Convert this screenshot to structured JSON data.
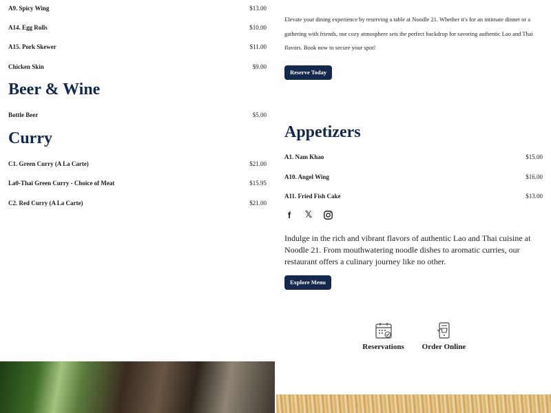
{
  "left_menu": {
    "top_items": [
      {
        "name": "A9. Spicy Wing",
        "price": "$13.00"
      },
      {
        "name": "A14. Egg Rolls",
        "price": "$10.00"
      },
      {
        "name": "A15. Pork Skewer",
        "price": "$11.00"
      },
      {
        "name": "Chicken Skin",
        "price": "$9.00"
      }
    ],
    "beer_heading": "Beer & Wine",
    "beer_items": [
      {
        "name": "Bottle Beer",
        "price": "$5.00"
      }
    ],
    "curry_heading": "Curry",
    "curry_items": [
      {
        "name": "C1. Green Curry (A La Carte)",
        "price": "$21.00"
      },
      {
        "name": "La0-Thai Green Curry - Choice of Meat",
        "price": "$15.95"
      },
      {
        "name": "C2. Red Curry (A La Carte)",
        "price": "$21.00"
      }
    ]
  },
  "reserve": {
    "text": "Elevate your dining experience by reserving a table at Noodle 21. Whether it's for an intimate dinner or a gathering with friends, our cozy atmosphere sets the perfect backdrop for savoring authentic Lao and Thai flavors. Book now to secure your spot!",
    "button": "Reserve Today"
  },
  "appetizers": {
    "heading": "Appetizers",
    "items": [
      {
        "name": "A1. Nam Khao",
        "price": "$15.00"
      },
      {
        "name": "A10. Angel Wing",
        "price": "$16.00"
      },
      {
        "name": "A11. Fried Fish Cake",
        "price": "$13.00"
      }
    ]
  },
  "social": {
    "facebook_glyph": "f",
    "x_glyph": "𝕏"
  },
  "intro": {
    "text": "Indulge in the rich and vibrant flavors of authentic Lao and Thai cuisine at Noodle 21. From mouthwatering noodle dishes to aromatic curries, our restaurant offers a culinary journey like no other.",
    "button": "Explore Menu"
  },
  "features": {
    "reservations": "Reservations",
    "order_online": "Order Online"
  },
  "colors": {
    "accent": "#14284b"
  }
}
